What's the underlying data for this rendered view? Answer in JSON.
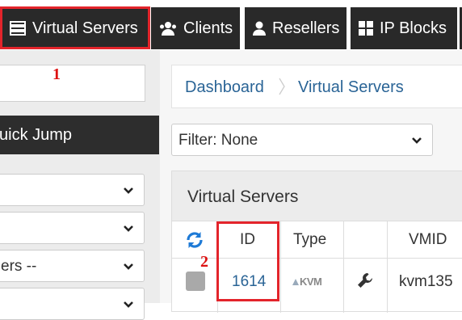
{
  "topnav": {
    "items": [
      {
        "label": "Virtual Servers",
        "icon": "server-icon"
      },
      {
        "label": "Clients",
        "icon": "users-icon"
      },
      {
        "label": "Resellers",
        "icon": "user-icon"
      },
      {
        "label": "IP Blocks",
        "icon": "grid-icon"
      }
    ]
  },
  "annotations": {
    "marker1": "1",
    "marker2": "2"
  },
  "sidebar": {
    "search_value": "",
    "quick_jump": "uick Jump",
    "selects": [
      "",
      "",
      "ers --",
      ""
    ]
  },
  "breadcrumb": {
    "items": [
      "Dashboard",
      "Virtual Servers"
    ]
  },
  "filter": {
    "value": "Filter: None"
  },
  "panel": {
    "title": "Virtual Servers",
    "columns": [
      "",
      "ID",
      "Type",
      "",
      "VMID"
    ],
    "rows": [
      {
        "id": "1614",
        "type": "KVM",
        "vmid": "kvm135"
      }
    ]
  },
  "colors": {
    "nav_bg": "#292929",
    "highlight": "#e3242b",
    "link": "#2a6496",
    "refresh_icon": "#1e7ad6"
  }
}
